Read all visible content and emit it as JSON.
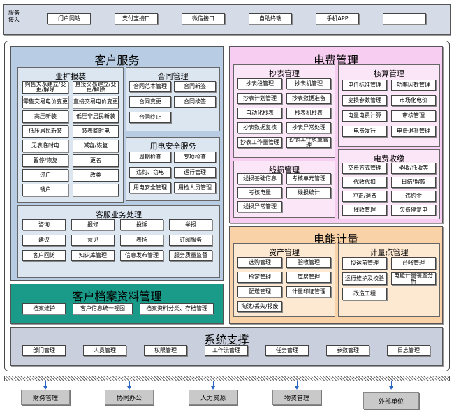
{
  "service_access": {
    "label": "服务\n接入",
    "items": [
      "门户网站",
      "支付宝接口",
      "微信接口",
      "自助终端",
      "手机APP",
      "……"
    ]
  },
  "customer_service": {
    "title": "客户服务",
    "business": {
      "title": "业扩报装",
      "items": [
        "购售关系建立/变更/解除",
        "直接交易建立/变更/解除",
        "零售交易电价变更",
        "直接交易电价变更",
        "高压新装",
        "低压非居民新装",
        "低压居民新装",
        "装表临时电",
        "无表临时电",
        "减容/恢复",
        "暂停/恢复",
        "更名",
        "过户",
        "改类",
        "销户",
        "……"
      ]
    },
    "contract": {
      "title": "合同管理",
      "items": [
        "合同范本管理",
        "合同新签",
        "合同变更",
        "合同续签",
        "合同终止"
      ]
    },
    "safety": {
      "title": "用电安全服务",
      "items": [
        "周期检查",
        "专项检查",
        "违约、窃电",
        "运行管理",
        "用电安全管理",
        "用检人员管理"
      ]
    },
    "handling": {
      "title": "客服业务处理",
      "items": [
        "咨询",
        "报修",
        "投诉",
        "举报",
        "建议",
        "意见",
        "表扬",
        "订阅服务",
        "客户回访",
        "知识库管理",
        "信息发布管理",
        "服务质量监督"
      ]
    }
  },
  "archive": {
    "title": "客户档案资料管理",
    "items": [
      "档案维护",
      "客户信息统一视图",
      "档案资料分类、存档管理"
    ]
  },
  "billing": {
    "title": "电费管理",
    "meter_reading": {
      "title": "抄表管理",
      "items": [
        "抄表段管理",
        "抄表机管理",
        "抄表计划管理",
        "抄表数据准备",
        "自动化抄表",
        "抄表机抄表",
        "抄表数据复核",
        "抄表异常处理",
        "抄表工作量管理",
        "抄表工作质量管理"
      ]
    },
    "accounting": {
      "title": "核算管理",
      "items": [
        "电价标准管理",
        "功率因数管理",
        "变损参数管理",
        "市场化电价",
        "电量电费计算",
        "审核管理",
        "电费发行",
        "电费退补管理"
      ]
    },
    "line_loss": {
      "title": "线损管理",
      "items": [
        "线损基础信息",
        "考核单元管理",
        "考核电量",
        "线损统计",
        "线损异常管理"
      ]
    },
    "collection": {
      "title": "电费收缴",
      "items": [
        "交费方式管理",
        "坐收/托收等",
        "代收代扣",
        "日结/解款",
        "冲正/退费",
        "违约金",
        "催收管理",
        "欠费停复电"
      ]
    }
  },
  "metering": {
    "title": "电能计量",
    "assets": {
      "title": "资产管理",
      "items": [
        "选购管理",
        "验收管理",
        "检定管理",
        "库房管理",
        "配送管理",
        "计量印证管理",
        "淘汰/丢失/报废"
      ]
    },
    "points": {
      "title": "计量点管理",
      "items": [
        "投运前管理",
        "台帐管理",
        "运行维护及校验",
        "电能计量装置分析",
        "改造工程"
      ]
    }
  },
  "system": {
    "title": "系统支撑",
    "items": [
      "部门管理",
      "人员管理",
      "权限管理",
      "工作流管理",
      "任务管理",
      "参数管理",
      "日志管理"
    ]
  },
  "external": [
    "财务管理",
    "协同办公",
    "人力资源",
    "物资管理",
    "外部单位"
  ],
  "colors": {
    "customer_bg": "#b8cde4",
    "archive_bg": "#1a9b8a",
    "billing_bg": "#f7cdf1",
    "metering_bg": "#fad2a8",
    "system_bg": "#c9cfdc",
    "access_bg": "#d6dbe8",
    "arrow": "#2a66c4"
  }
}
